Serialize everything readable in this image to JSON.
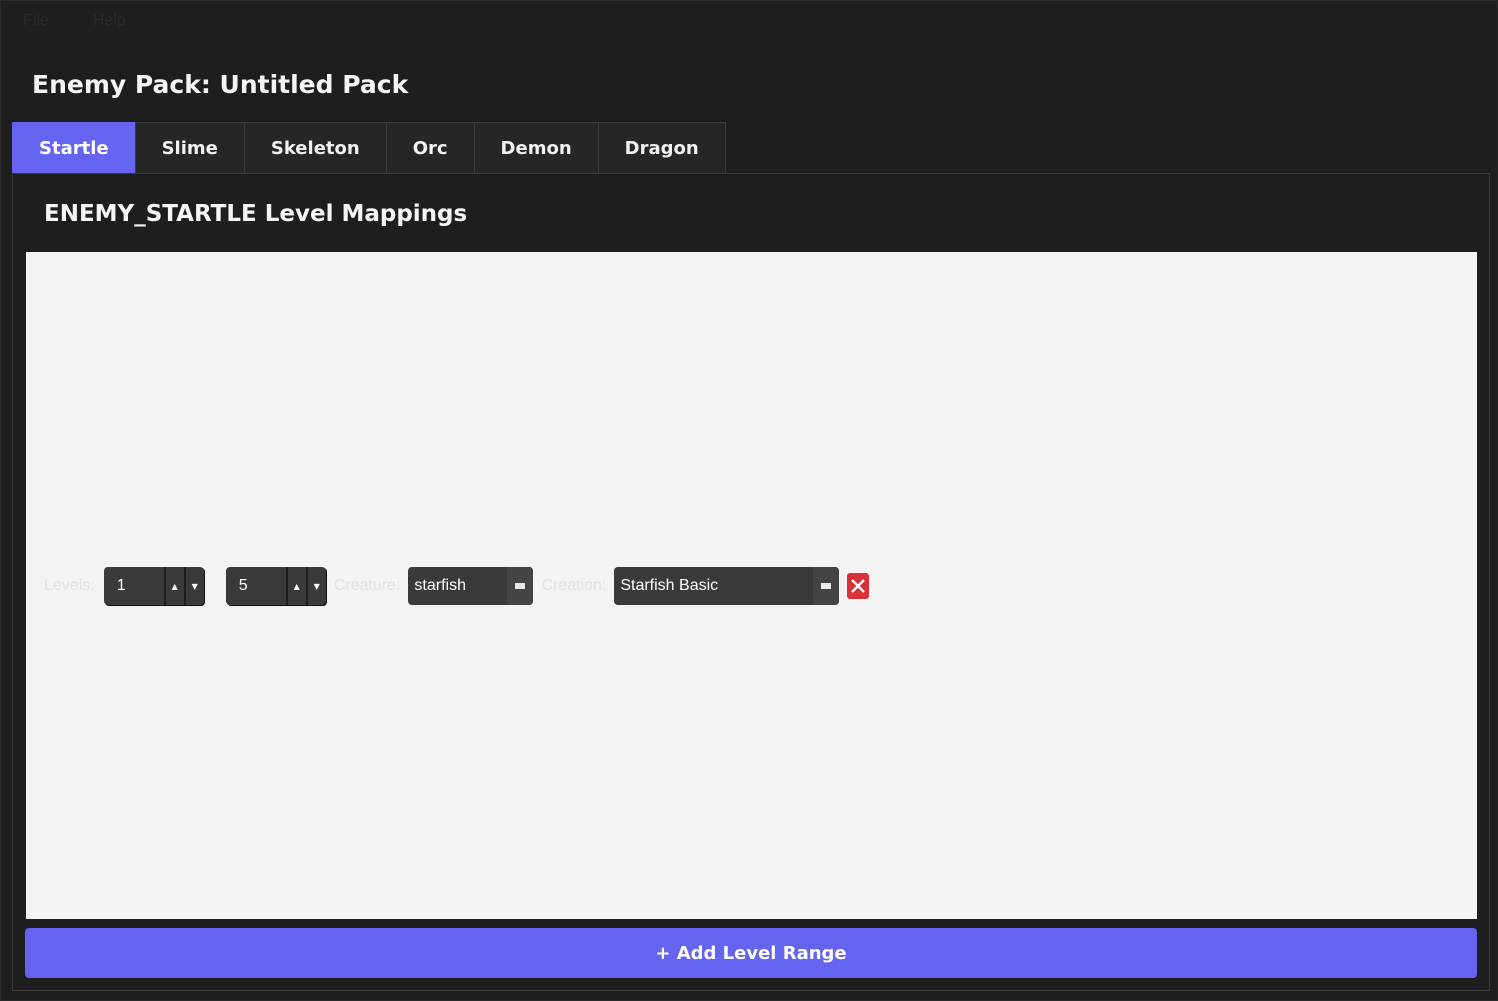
{
  "menu": {
    "items": [
      "File",
      "Help"
    ]
  },
  "pack": {
    "title": "Enemy Pack: Untitled Pack"
  },
  "tabs": [
    {
      "label": "Startle",
      "active": true
    },
    {
      "label": "Slime",
      "active": false
    },
    {
      "label": "Skeleton",
      "active": false
    },
    {
      "label": "Orc",
      "active": false
    },
    {
      "label": "Demon",
      "active": false
    },
    {
      "label": "Dragon",
      "active": false
    }
  ],
  "section": {
    "title": "ENEMY_STARTLE Level Mappings"
  },
  "mapping": {
    "levels_label": "Levels:",
    "level_min": "1",
    "level_max": "5",
    "creature_label": "Creature:",
    "creature_value": "starfish",
    "creation_label": "Creation:",
    "creation_value": "Starfish Basic"
  },
  "actions": {
    "add_label": "+ Add Level Range"
  },
  "colors": {
    "accent": "#6464f0",
    "background": "#1e1e1e",
    "mapping_area": "#f3f3f3",
    "remove": "#d9303a"
  }
}
